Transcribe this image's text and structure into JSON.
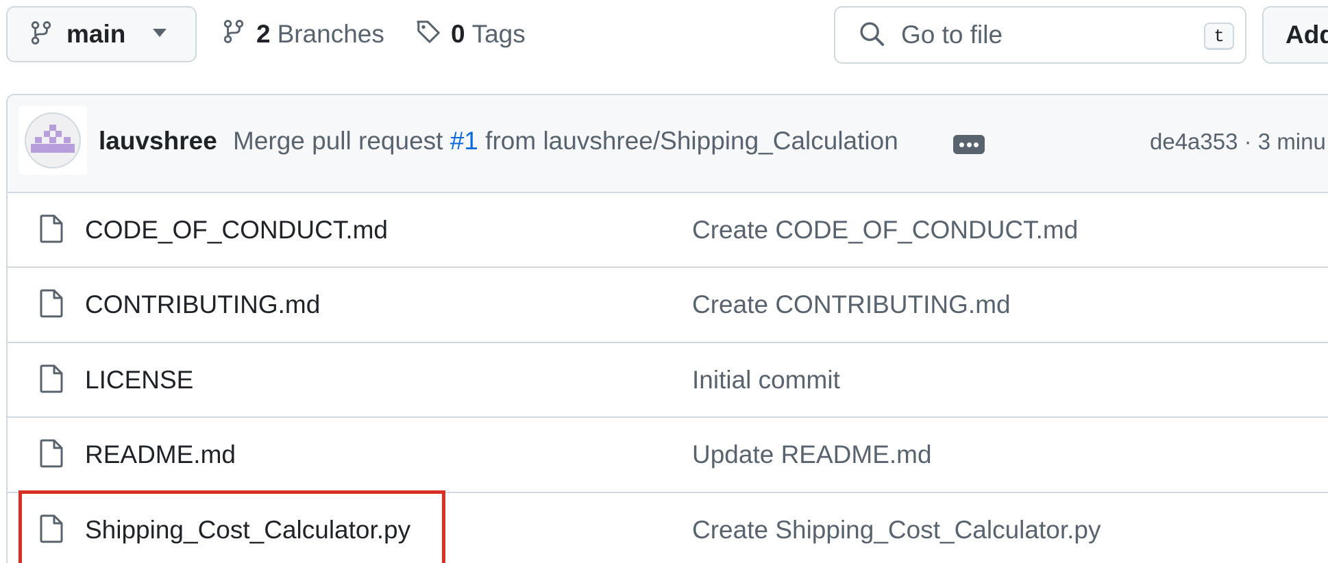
{
  "toolbar": {
    "branch_name": "main",
    "branches_count": "2",
    "branches_label": "Branches",
    "tags_count": "0",
    "tags_label": "Tags",
    "search_placeholder": "Go to file",
    "search_shortcut": "t",
    "add_label": "Add"
  },
  "commit": {
    "author": "lauvshree",
    "message_prefix": "Merge pull request ",
    "pr_number": "#1",
    "message_suffix": " from lauvshree/Shipping_Calculation",
    "meta": "de4a353 · 3 minu"
  },
  "files": [
    {
      "name": "CODE_OF_CONDUCT.md",
      "commit": "Create CODE_OF_CONDUCT.md"
    },
    {
      "name": "CONTRIBUTING.md",
      "commit": "Create CONTRIBUTING.md"
    },
    {
      "name": "LICENSE",
      "commit": "Initial commit"
    },
    {
      "name": "README.md",
      "commit": "Update README.md"
    },
    {
      "name": "Shipping_Cost_Calculator.py",
      "commit": "Create Shipping_Cost_Calculator.py"
    }
  ],
  "colors": {
    "border": "#d1d9e0",
    "muted_text": "#59636e",
    "link": "#0969da",
    "header_bg": "#f6f8fa",
    "highlight": "#d93025",
    "avatar_purple": "#b79fdc"
  },
  "highlighted_file": "Shipping_Cost_Calculator.py"
}
